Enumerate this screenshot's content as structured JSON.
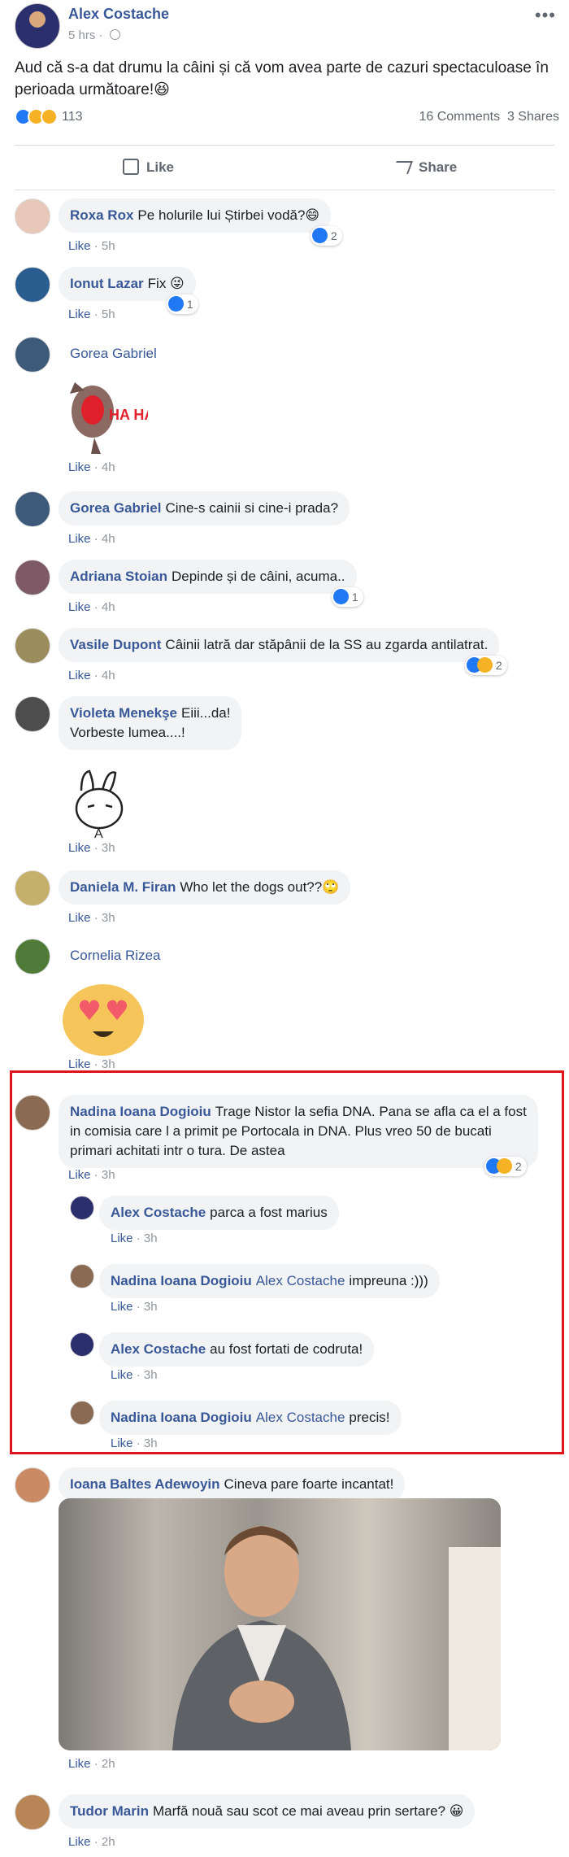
{
  "post": {
    "author": "Alex Costache",
    "time": "5 hrs",
    "text": "Aud că s-a dat drumu la câini și că vom avea parte de cazuri spectaculoase în perioada următoare!😆",
    "reaction_count": "113",
    "comments_count": "16 Comments",
    "shares_count": "3 Shares",
    "reaction_icons": [
      "like-icon",
      "haha-icon",
      "wow-icon"
    ]
  },
  "actions": {
    "like": "Like",
    "share": "Share"
  },
  "colors": {
    "link": "#385898",
    "meta": "#90949c",
    "bubble": "#f2f3f5",
    "highlight": "#e0131b",
    "like_blue": "#2078f4"
  },
  "comments": [
    {
      "author": "Roxa Rox",
      "text": "Pe holurile lui Știrbei vodă?😄",
      "like": "Like",
      "time": "5h",
      "reactions": "2"
    },
    {
      "author": "Ionut Lazar",
      "text": "Fix 😜",
      "like": "Like",
      "time": "5h",
      "reactions": "1"
    },
    {
      "author": "Gorea Gabriel",
      "text": "",
      "sticker_text": "HA HA",
      "like": "Like",
      "time": "4h"
    },
    {
      "author": "Gorea Gabriel",
      "text": "Cine-s cainii si cine-i prada?",
      "like": "Like",
      "time": "4h"
    },
    {
      "author": "Adriana Stoian",
      "text": "Depinde și de câini, acuma..",
      "like": "Like",
      "time": "4h",
      "reactions": "1"
    },
    {
      "author": "Vasile Dupont",
      "text": "Câinii latră dar stăpânii de la SS au zgarda antilatrat.",
      "like": "Like",
      "time": "4h",
      "reactions": "2"
    },
    {
      "author": "Violeta Menekşe",
      "text": "Eiii...da!",
      "text2": "Vorbeste lumea....!",
      "sticker_text": "A",
      "like": "Like",
      "time": "3h"
    },
    {
      "author": "Daniela M. Firan",
      "text": "Who let the dogs out??🙄",
      "like": "Like",
      "time": "3h"
    },
    {
      "author": "Cornelia Rizea",
      "text": "",
      "like": "Like",
      "time": "3h"
    },
    {
      "author": "Nadina Ioana Dogioiu",
      "text": "Trage Nistor la sefia DNA. Pana se afla ca el a fost in comisia care l a primit pe Portocala in DNA. Plus vreo 50 de bucati primari achitati intr o tura. De astea",
      "like": "Like",
      "time": "3h",
      "reactions": "2"
    },
    {
      "author": "Ioana Baltes Adewoyin",
      "text": "Cineva pare foarte incantat!",
      "like": "Like",
      "time": "2h"
    },
    {
      "author": "Tudor Marin",
      "text": "Marfă nouă sau scot ce mai aveau prin sertare? 😀",
      "like": "Like",
      "time": "2h"
    }
  ],
  "replies": [
    {
      "author": "Alex Costache",
      "tag": "",
      "text": "parca a fost marius",
      "like": "Like",
      "time": "3h"
    },
    {
      "author": "Nadina Ioana Dogioiu",
      "tag": "Alex Costache",
      "text": "impreuna :)))",
      "like": "Like",
      "time": "3h"
    },
    {
      "author": "Alex Costache",
      "tag": "",
      "text": "au fost fortati de codruta!",
      "like": "Like",
      "time": "3h"
    },
    {
      "author": "Nadina Ioana Dogioiu",
      "tag": "Alex Costache",
      "text": "precis!",
      "like": "Like",
      "time": "3h"
    }
  ]
}
